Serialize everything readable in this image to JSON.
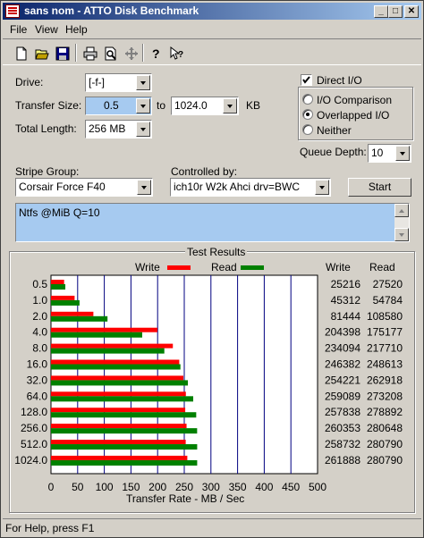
{
  "window": {
    "title": "sans nom - ATTO Disk Benchmark",
    "min_glyph": "_",
    "max_glyph": "□",
    "close_glyph": "✕"
  },
  "menu": {
    "file": "File",
    "view": "View",
    "help": "Help"
  },
  "toolbar": {
    "icons": [
      "new-file-icon",
      "open-folder-icon",
      "save-disk-icon",
      "print-icon",
      "print-preview-icon",
      "move-cross-icon",
      "help-question-icon",
      "context-help-icon"
    ]
  },
  "form": {
    "drive_label": "Drive:",
    "drive_value": "[-f-]",
    "transfer_size_label": "Transfer Size:",
    "transfer_from": "0.5",
    "to_label": "to",
    "transfer_to": "1024.0",
    "kb_label": "KB",
    "total_length_label": "Total Length:",
    "total_length_value": "256 MB",
    "direct_io_label": "Direct I/O",
    "direct_io_checked": true,
    "io_comparison_label": "I/O Comparison",
    "overlapped_io_label": "Overlapped I/O",
    "neither_label": "Neither",
    "selected_mode": "Overlapped I/O",
    "queue_depth_label": "Queue Depth:",
    "queue_depth_value": "10",
    "stripe_group_label": "Stripe Group:",
    "stripe_group_value": "Corsair Force F40",
    "controlled_by_label": "Controlled by:",
    "controlled_by_value": "ich10r W2k Ahci drv=BWC",
    "start_button": "Start",
    "notes": "Ntfs @MiB Q=10"
  },
  "results": {
    "group_title": "Test Results",
    "legend_write": "Write",
    "legend_read": "Read",
    "col_write": "Write",
    "col_read": "Read",
    "xlabel": "Transfer Rate - MB / Sec"
  },
  "colors": {
    "write": "#ff0000",
    "read": "#008000",
    "grid": "#000080",
    "title_start": "#0a246a",
    "title_end": "#a6caf0",
    "field_highlight": "#a6caf0"
  },
  "chart_data": {
    "type": "bar",
    "orientation": "horizontal",
    "title": "Test Results",
    "xlabel": "Transfer Rate - MB / Sec",
    "xlim": [
      0,
      500
    ],
    "xticks": [
      0,
      50,
      100,
      150,
      200,
      250,
      300,
      350,
      400,
      450,
      500
    ],
    "grid": true,
    "legend": "top",
    "categories": [
      "0.5",
      "1.0",
      "2.0",
      "4.0",
      "8.0",
      "16.0",
      "32.0",
      "64.0",
      "128.0",
      "256.0",
      "512.0",
      "1024.0"
    ],
    "series": [
      {
        "name": "Write",
        "values": [
          24.6,
          44.3,
          79.5,
          199.6,
          228.6,
          240.6,
          248.3,
          253.0,
          251.8,
          254.3,
          252.7,
          255.7
        ],
        "table": [
          "25216",
          "45312",
          "81444",
          "204398",
          "234094",
          "246382",
          "254221",
          "259089",
          "257838",
          "260353",
          "258732",
          "261888"
        ]
      },
      {
        "name": "Read",
        "values": [
          26.9,
          53.5,
          106.0,
          171.1,
          212.6,
          242.8,
          256.8,
          266.8,
          272.4,
          274.1,
          274.2,
          274.2
        ],
        "table": [
          "27520",
          "54784",
          "108580",
          "175177",
          "217710",
          "248613",
          "262918",
          "273208",
          "278892",
          "280648",
          "280790",
          "280790"
        ]
      }
    ]
  },
  "status": {
    "text": "For Help, press F1"
  }
}
